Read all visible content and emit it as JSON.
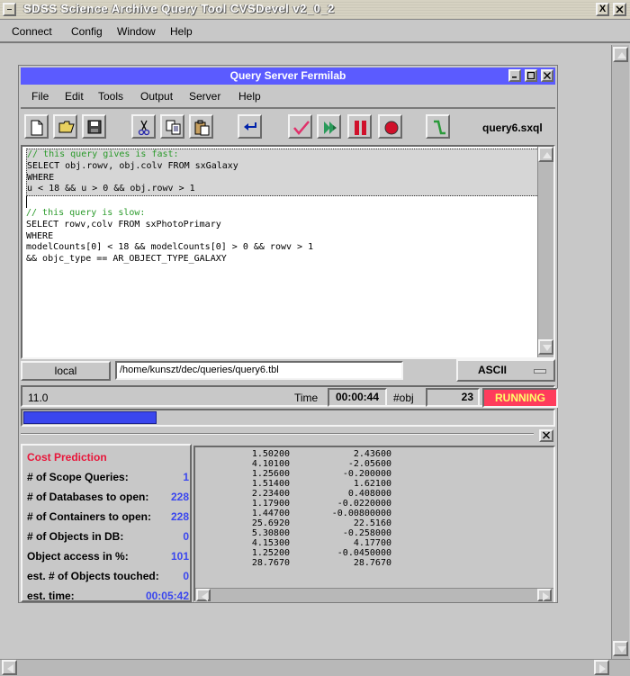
{
  "app": {
    "title": "SDSS Science Archive Query Tool  CVSDevel v2_0_2",
    "menu": [
      "Connect",
      "Config",
      "Window",
      "Help"
    ],
    "window_buttons": [
      "_",
      "X"
    ]
  },
  "query_window": {
    "title": "Query Server Fermilab",
    "menu": [
      "File",
      "Edit",
      "Tools",
      "Output",
      "Server",
      "Help"
    ],
    "file_name": "query6.sxql",
    "toolbar": [
      "new-file-icon",
      "open-folder-icon",
      "save-icon",
      "cut-icon",
      "copy-icon",
      "paste-icon",
      "swap-icon",
      "check-icon",
      "run-icon",
      "pause-icon",
      "stop-icon",
      "step-icon"
    ],
    "editor_lines": [
      {
        "text": "// this query gives is fast:",
        "comment": true,
        "selected": true
      },
      {
        "text": "SELECT obj.rowv, obj.colv FROM sxGalaxy",
        "comment": false,
        "selected": true
      },
      {
        "text": "WHERE",
        "comment": false,
        "selected": true
      },
      {
        "text": "u < 18 && u > 0 && obj.rowv > 1",
        "comment": false,
        "selected": true
      },
      {
        "text": "",
        "comment": false,
        "selected": false
      },
      {
        "text": "// this query is slow:",
        "comment": true,
        "selected": false
      },
      {
        "text": "SELECT rowv,colv FROM sxPhotoPrimary",
        "comment": false,
        "selected": false
      },
      {
        "text": "WHERE",
        "comment": false,
        "selected": false
      },
      {
        "text": "modelCounts[0] < 18 && modelCounts[0] > 0 && rowv > 1",
        "comment": false,
        "selected": false
      },
      {
        "text": "&& objc_type == AR_OBJECT_TYPE_GALAXY",
        "comment": false,
        "selected": false
      }
    ],
    "output_mode": "local",
    "output_path": "/home/kunszt/dec/queries/query6.tbl",
    "format": "ASCII",
    "status_value": "11.0",
    "time_label": "Time",
    "time_value": "00:00:44",
    "obj_label": "#obj",
    "obj_value": "23",
    "state": "RUNNING",
    "progress": 0.25,
    "colors": {
      "running_bg": "#ff3c5c",
      "running_fg": "#ffff6a",
      "progress": "#3a46ee",
      "cost_title": "#e8163a",
      "comment": "#2a9a2a"
    }
  },
  "cost_prediction": {
    "title": "Cost Prediction",
    "rows": [
      {
        "label": "# of Scope Queries:",
        "value": "1"
      },
      {
        "label": "# of Databases to open:",
        "value": "228"
      },
      {
        "label": "# of Containers to open:",
        "value": "228"
      },
      {
        "label": "# of Objects in DB:",
        "value": "0"
      },
      {
        "label": "Object access in %:",
        "value": "101"
      },
      {
        "label": "est. # of Objects touched:",
        "value": "0"
      },
      {
        "label": "est. time:",
        "value": "00:05:42"
      }
    ]
  },
  "results": [
    [
      "1.50200",
      "2.43600"
    ],
    [
      "4.10100",
      "-2.05600"
    ],
    [
      "1.25600",
      "-0.200000"
    ],
    [
      "1.51400",
      "1.62100"
    ],
    [
      "2.23400",
      "0.408000"
    ],
    [
      "1.17900",
      "-0.0220000"
    ],
    [
      "1.44700",
      "-0.00800000"
    ],
    [
      "25.6920",
      "22.5160"
    ],
    [
      "5.30800",
      "-0.258000"
    ],
    [
      "4.15300",
      "4.17700"
    ],
    [
      "1.25200",
      "-0.0450000"
    ],
    [
      "28.7670",
      "28.7670"
    ]
  ]
}
